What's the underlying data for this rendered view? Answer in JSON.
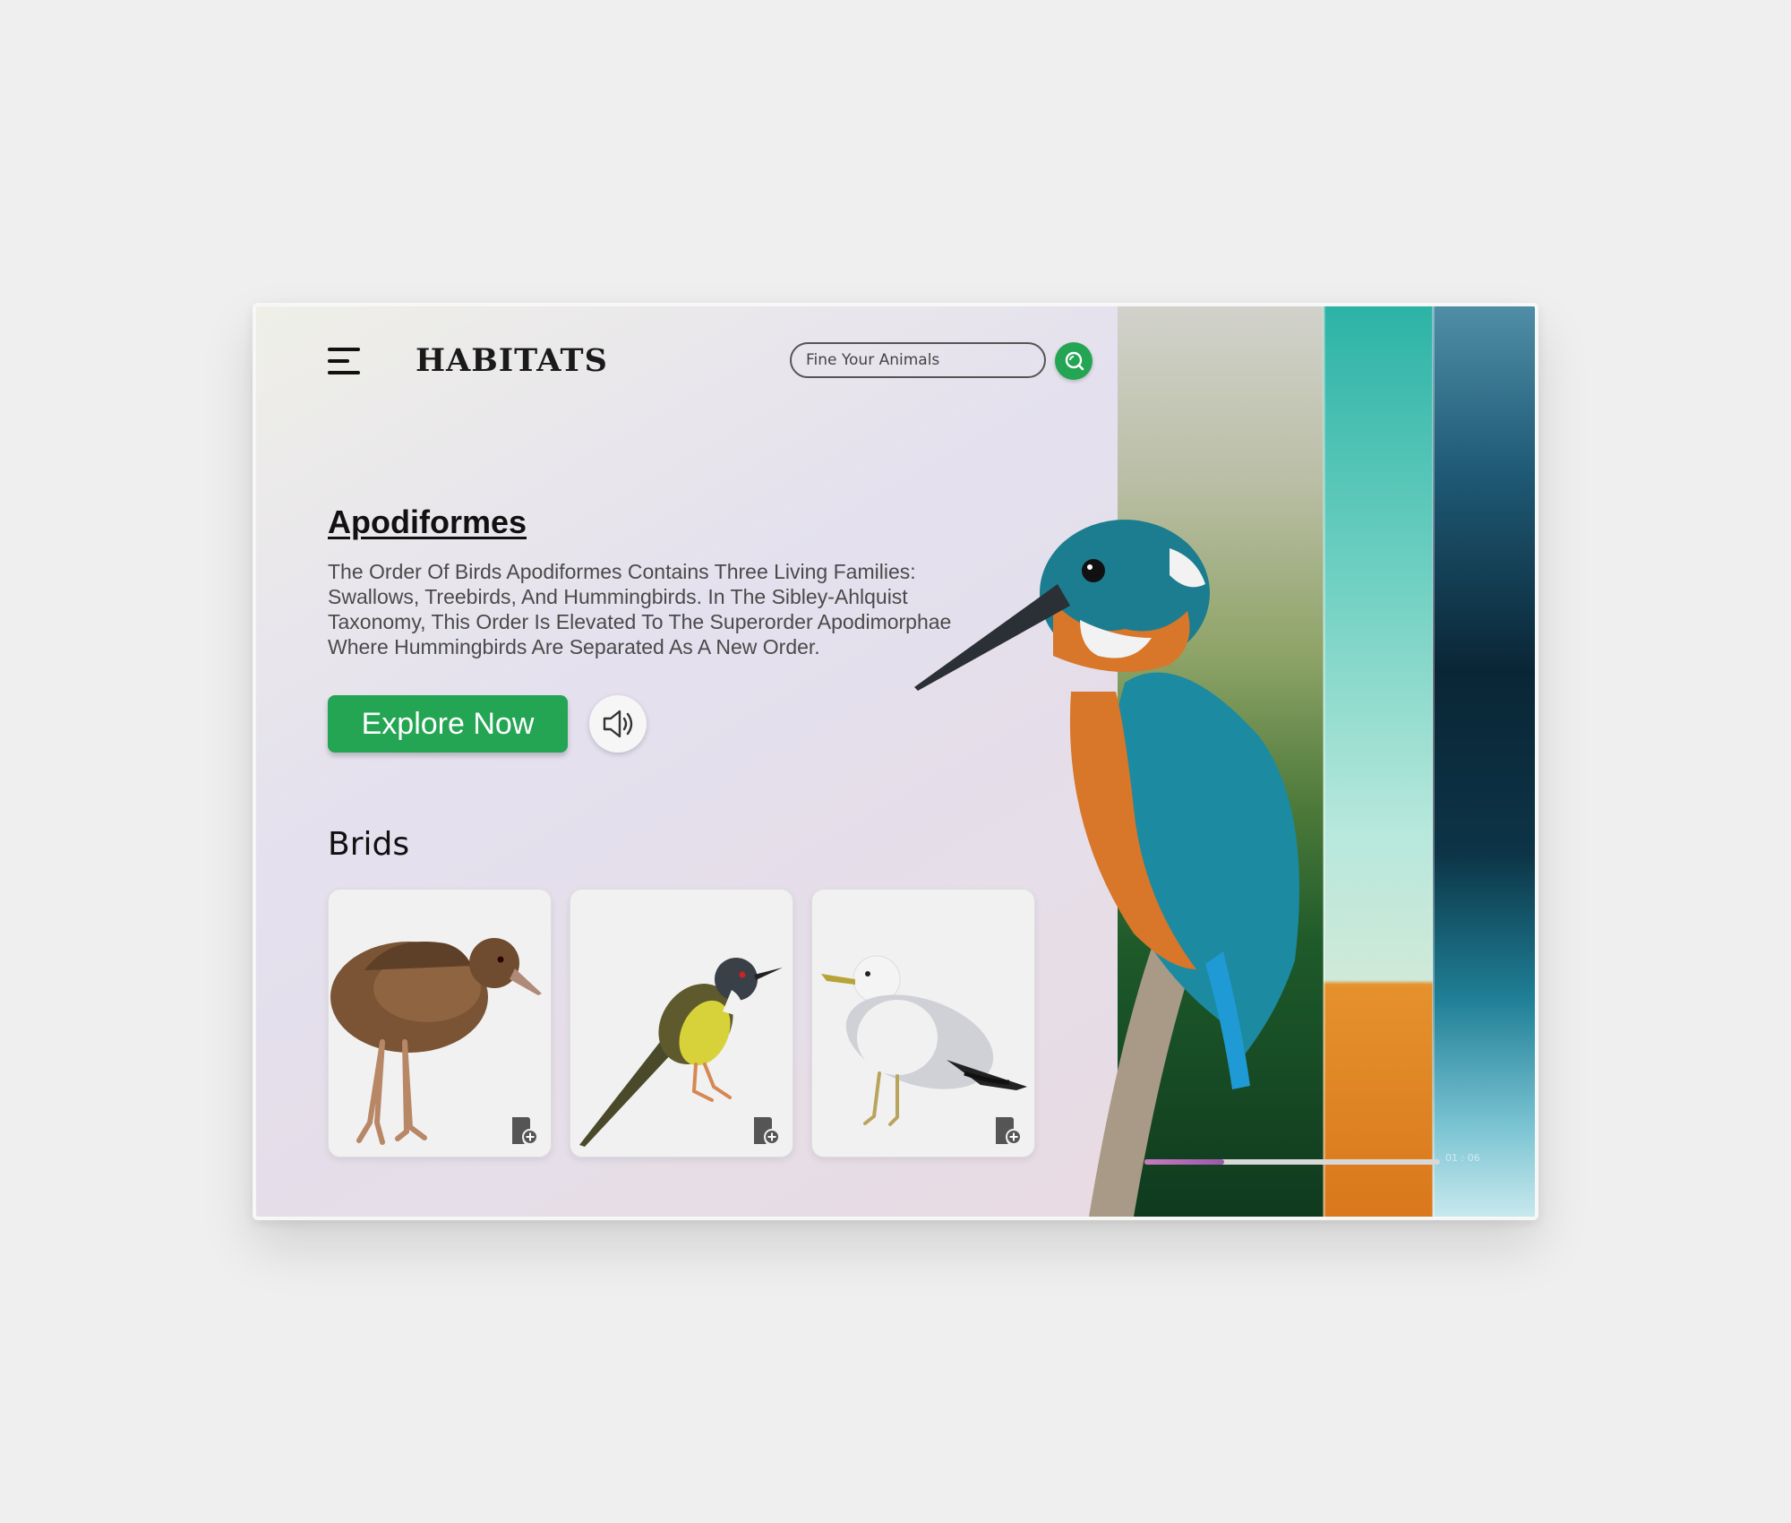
{
  "header": {
    "app_title": "HABITATS",
    "search_placeholder": "Fine Your Animals",
    "menu_icon": "hamburger-menu-icon",
    "search_icon": "search-icon"
  },
  "hero": {
    "title": "Apodiformes",
    "description": "The Order Of Birds Apodiformes Contains Three Living Families: Swallows, Treebirds, And Hummingbirds. In The Sibley-Ahlquist Taxonomy, This Order Is Elevated To The Superorder Apodimorphae Where Hummingbirds Are Separated As A New Order.",
    "explore_label": "Explore Now",
    "sound_icon": "speaker-icon"
  },
  "birds_section": {
    "title": "Brids",
    "cards": [
      {
        "bird": "weka-bird",
        "action_icon": "bookmark-add-icon"
      },
      {
        "bird": "yellow-bellied-prinia",
        "action_icon": "bookmark-add-icon"
      },
      {
        "bird": "seagull",
        "action_icon": "bookmark-add-icon"
      }
    ]
  },
  "media_panel": {
    "habitats": [
      "forest",
      "desert",
      "ocean"
    ],
    "featured_bird": "kingfisher",
    "progress": 0.27,
    "time": "01 : 06"
  },
  "colors": {
    "accent_green": "#23a553",
    "progress_fill": "#b86cb6"
  }
}
